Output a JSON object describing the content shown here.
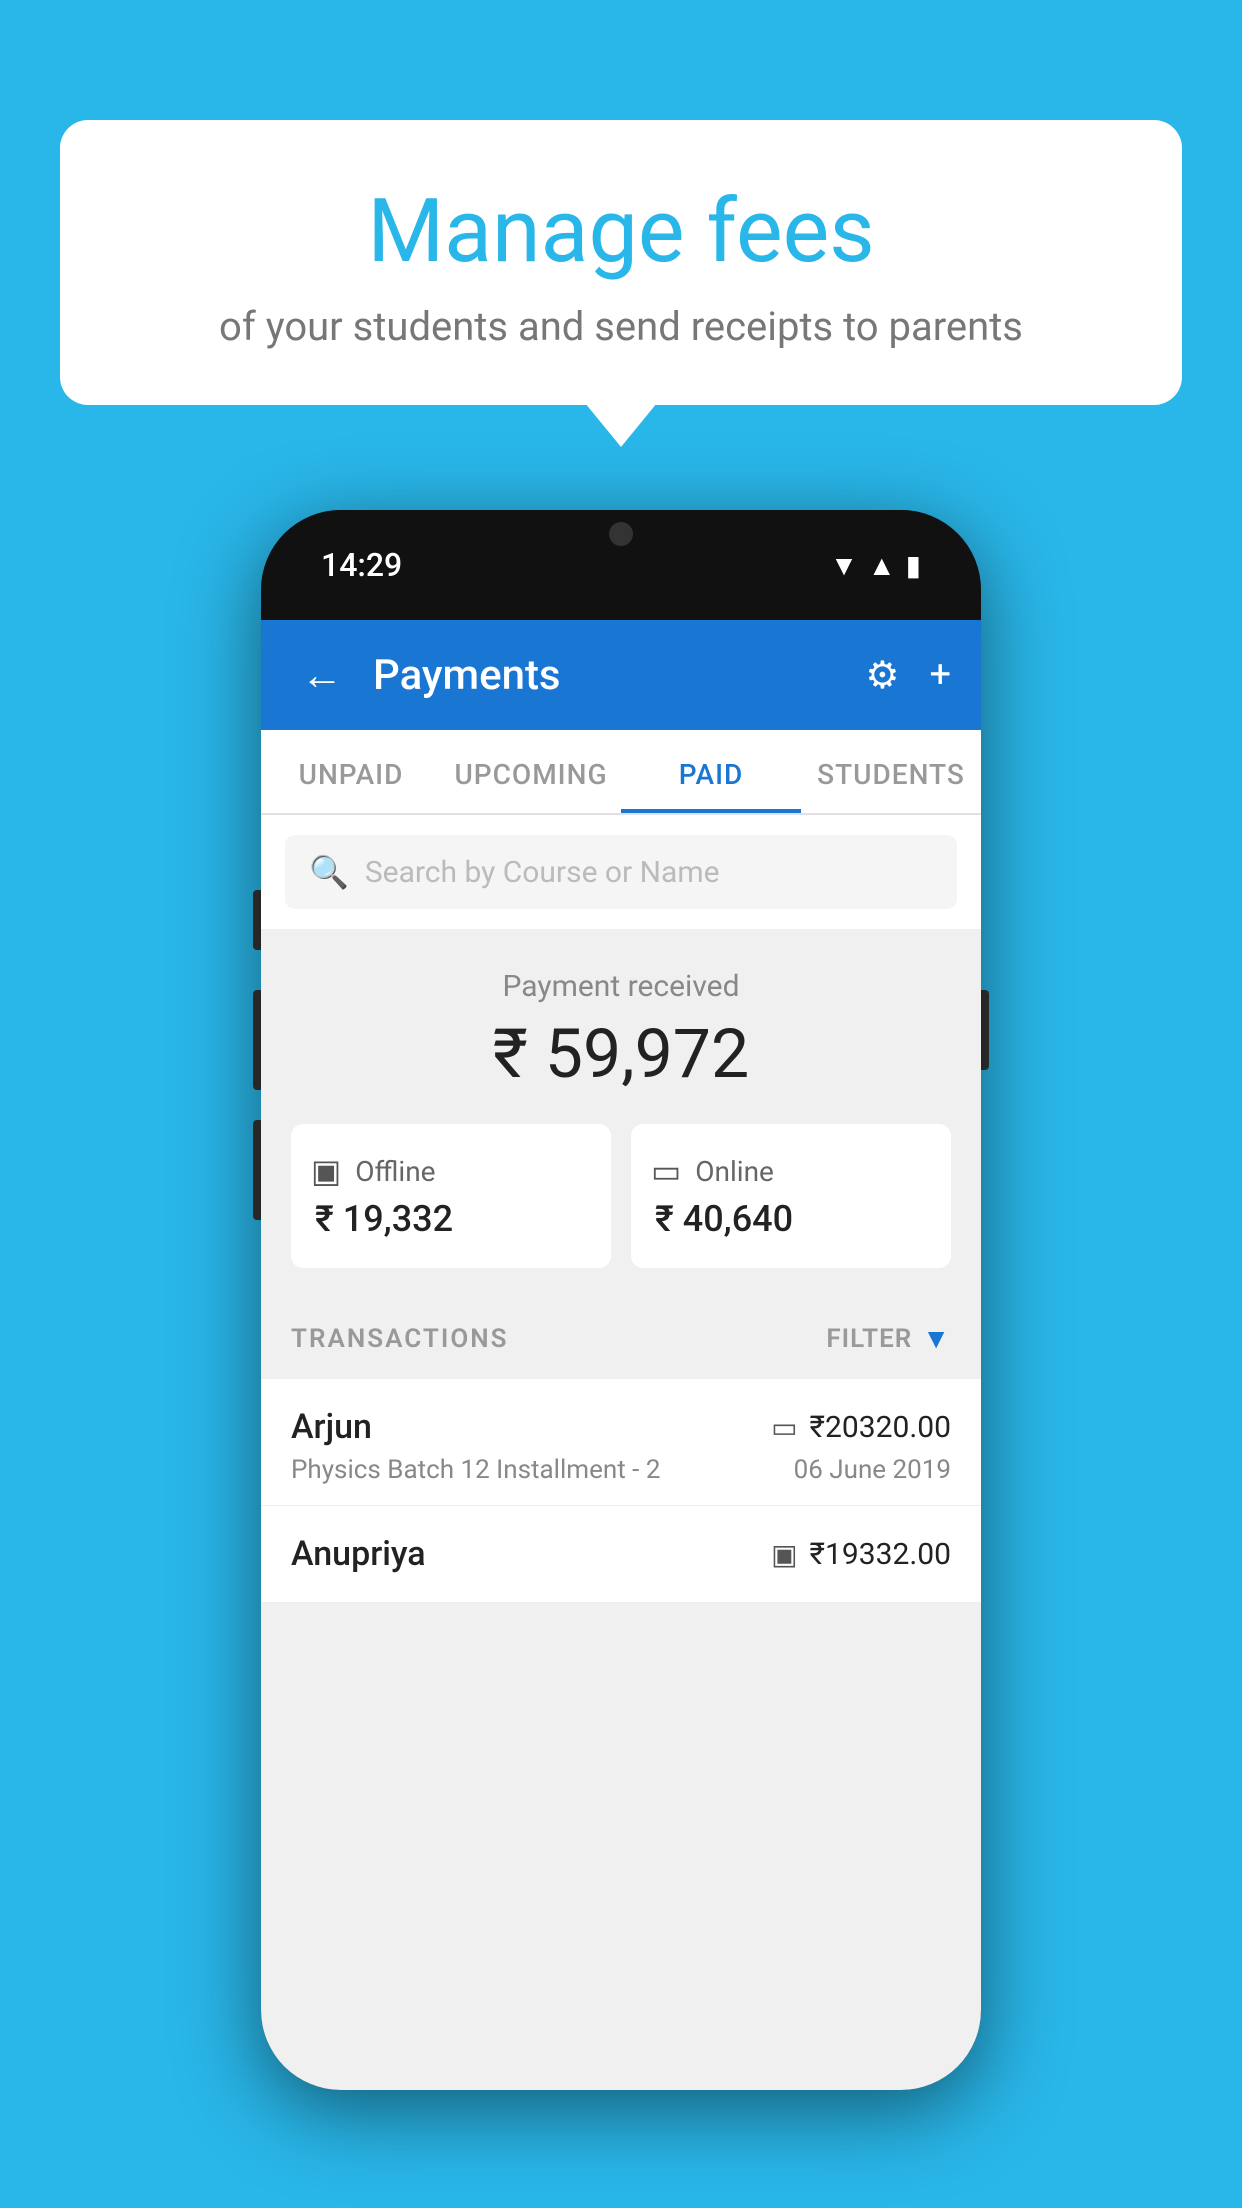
{
  "bubble": {
    "title": "Manage fees",
    "subtitle": "of your students and send receipts to parents"
  },
  "status_bar": {
    "time": "14:29",
    "icons": [
      "▲",
      "▲",
      "▮"
    ]
  },
  "header": {
    "title": "Payments",
    "back_label": "←",
    "settings_label": "⚙",
    "add_label": "+"
  },
  "tabs": [
    {
      "label": "UNPAID",
      "active": false
    },
    {
      "label": "UPCOMING",
      "active": false
    },
    {
      "label": "PAID",
      "active": true
    },
    {
      "label": "STUDENTS",
      "active": false
    }
  ],
  "search": {
    "placeholder": "Search by Course or Name"
  },
  "payment": {
    "label": "Payment received",
    "amount": "₹ 59,972",
    "offline": {
      "icon": "▣",
      "title": "Offline",
      "amount": "₹ 19,332"
    },
    "online": {
      "icon": "▭",
      "title": "Online",
      "amount": "₹ 40,640"
    }
  },
  "transactions": {
    "label": "TRANSACTIONS",
    "filter_label": "FILTER",
    "rows": [
      {
        "name": "Arjun",
        "course": "Physics Batch 12 Installment - 2",
        "amount": "₹20320.00",
        "date": "06 June 2019",
        "type_icon": "▭"
      },
      {
        "name": "Anupriya",
        "course": "",
        "amount": "₹19332.00",
        "date": "",
        "type_icon": "▣"
      }
    ]
  }
}
